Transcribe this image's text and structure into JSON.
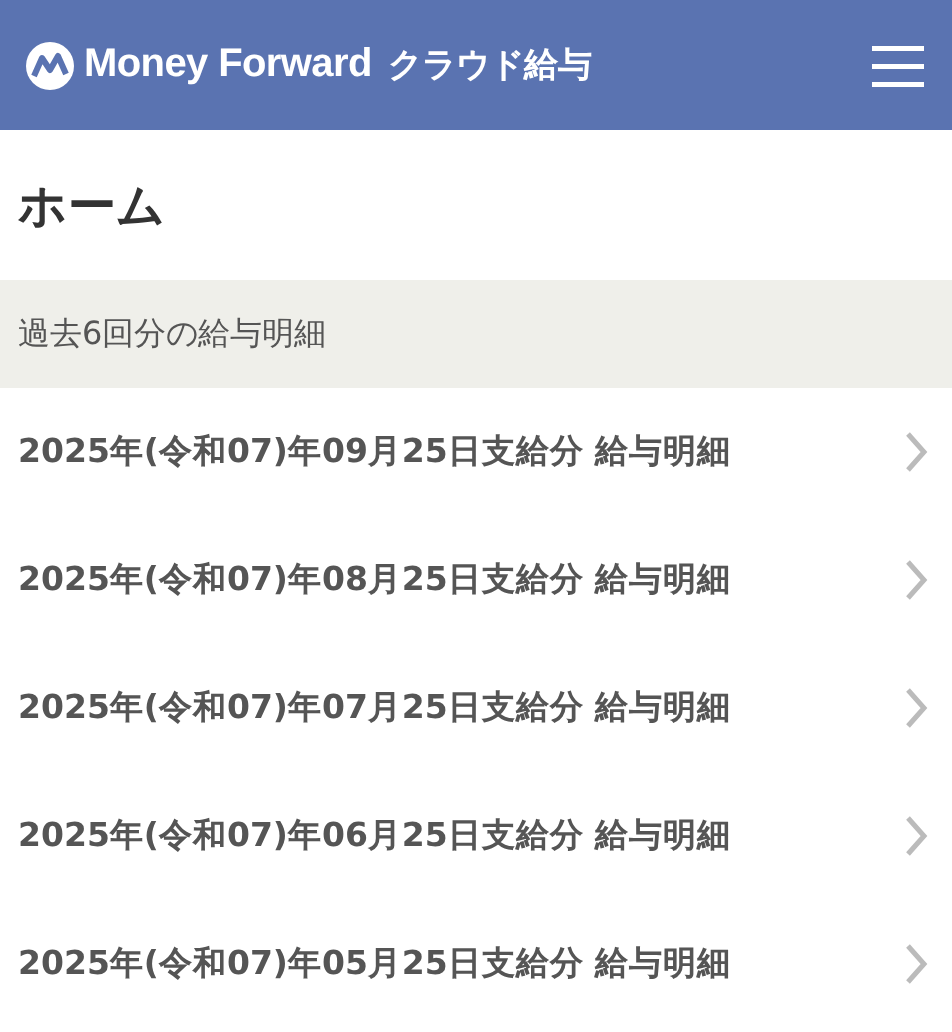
{
  "header": {
    "brand": "Money Forward",
    "product": "クラウド給与"
  },
  "page_title": "ホーム",
  "section": {
    "title": "過去6回分の給与明細"
  },
  "payslips": [
    {
      "label": "2025年(令和07)年09月25日支給分 給与明細"
    },
    {
      "label": "2025年(令和07)年08月25日支給分 給与明細"
    },
    {
      "label": "2025年(令和07)年07月25日支給分 給与明細"
    },
    {
      "label": "2025年(令和07)年06月25日支給分 給与明細"
    },
    {
      "label": "2025年(令和07)年05月25日支給分 給与明細"
    }
  ]
}
